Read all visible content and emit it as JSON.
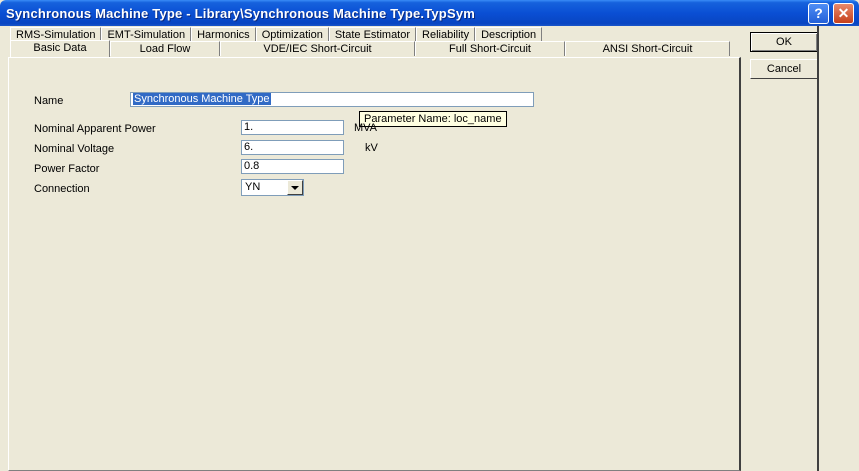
{
  "window": {
    "title": "Synchronous Machine Type - Library\\Synchronous Machine Type.TypSym",
    "help_label": "?",
    "close_label": "✕"
  },
  "tabs": {
    "row1": [
      "RMS-Simulation",
      "EMT-Simulation",
      "Harmonics",
      "Optimization",
      "State Estimator",
      "Reliability",
      "Description"
    ],
    "row2": [
      "Basic Data",
      "Load Flow",
      "VDE/IEC Short-Circuit",
      "Full Short-Circuit",
      "ANSI Short-Circuit"
    ],
    "active": "Basic Data"
  },
  "form": {
    "name_label": "Name",
    "name_value": "Synchronous Machine Type",
    "tooltip": "Parameter Name: loc_name",
    "apparent_power_label": "Nominal Apparent Power",
    "apparent_power_value": "1.",
    "apparent_power_unit": "MVA",
    "voltage_label": "Nominal Voltage",
    "voltage_value": "6.",
    "voltage_unit": "kV",
    "power_factor_label": "Power Factor",
    "power_factor_value": "0.8",
    "connection_label": "Connection",
    "connection_value": "YN"
  },
  "buttons": {
    "ok": "OK",
    "cancel": "Cancel"
  }
}
